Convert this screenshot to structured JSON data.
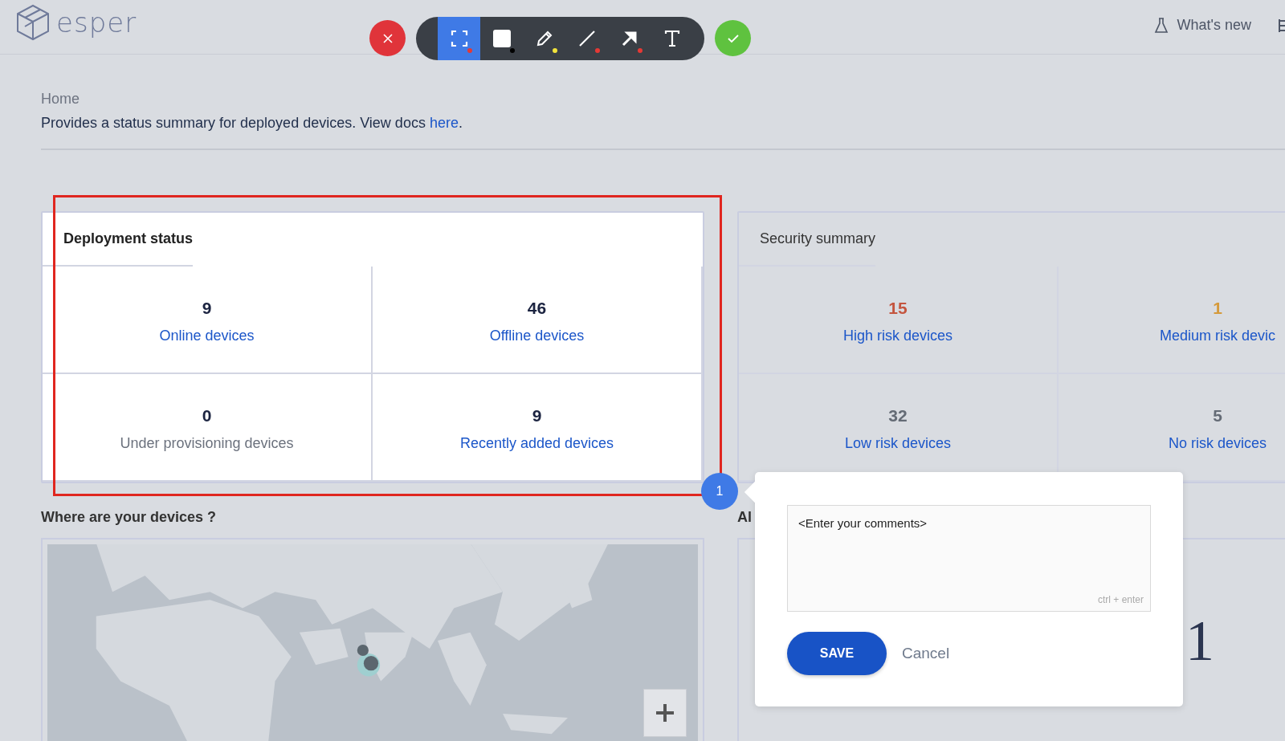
{
  "logo": {
    "text": "esper"
  },
  "annotation_toolbar": {
    "tools": [
      {
        "kind": "select",
        "selected": true,
        "color": "#e53935"
      },
      {
        "kind": "rectangle",
        "selected": false,
        "color": "#000000"
      },
      {
        "kind": "pen",
        "selected": false,
        "color": "#f2e43c"
      },
      {
        "kind": "line",
        "selected": false,
        "color": "#e53935"
      },
      {
        "kind": "arrow",
        "selected": false,
        "color": "#e53935"
      },
      {
        "kind": "text",
        "selected": false
      }
    ]
  },
  "header": {
    "whats_new": "What's new"
  },
  "breadcrumb": "Home",
  "description": {
    "text": "Provides a status summary for deployed devices. View docs ",
    "link": "here",
    "end": "."
  },
  "deployment_status": {
    "title": "Deployment status",
    "highlighted": true,
    "tiles": [
      {
        "value": "9",
        "label": "Online devices",
        "link": true
      },
      {
        "value": "46",
        "label": "Offline devices",
        "link": true
      },
      {
        "value": "0",
        "label": "Under provisioning devices",
        "link": false
      },
      {
        "value": "9",
        "label": "Recently added devices",
        "link": true
      }
    ]
  },
  "security_summary": {
    "title": "Security summary",
    "tiles": [
      {
        "value": "15",
        "label": "High risk devices",
        "color": "#c4553f"
      },
      {
        "value": "1",
        "label": "Medium risk devic",
        "color": "#d59a3b"
      },
      {
        "value": "32",
        "label": "Low risk devices",
        "color": "#646b75"
      },
      {
        "value": "5",
        "label": "No risk devices",
        "color": "#646b75"
      }
    ]
  },
  "map_section": {
    "title": "Where are your devices ?"
  },
  "alerts_section": {
    "title": "Al",
    "big_number": "1"
  },
  "annotation": {
    "number": "1",
    "placeholder": "<Enter your comments>",
    "hint": "ctrl + enter",
    "save": "SAVE",
    "cancel": "Cancel"
  }
}
